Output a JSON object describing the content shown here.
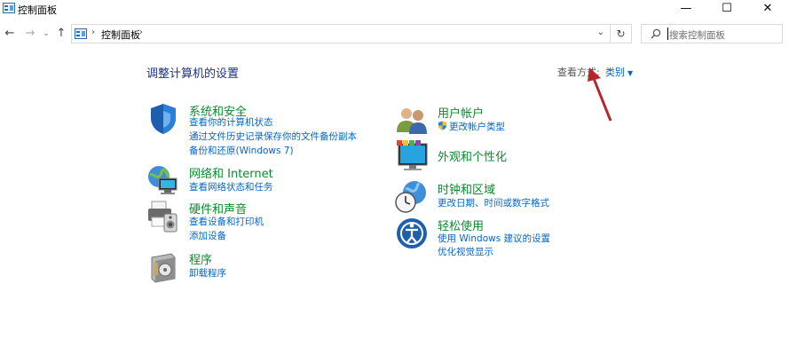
{
  "window": {
    "title": "控制面板",
    "minimize": "—",
    "maximize": "☐",
    "close": "✕"
  },
  "navigation": {
    "back": "←",
    "forward": "→",
    "recent": "⌄",
    "up": "↑",
    "separator": "›",
    "address_text": "控制面板",
    "dropdown": "⌄",
    "refresh": "↻",
    "search_placeholder": "搜索控制面板"
  },
  "main": {
    "heading": "调整计算机的设置",
    "view_by_label": "查看方式:",
    "view_by_value": "类别"
  },
  "left_categories": [
    {
      "title": "系统和安全",
      "links": [
        "查看你的计算机状态",
        "通过文件历史记录保存你的文件备份副本",
        "备份和还原(Windows 7)"
      ]
    },
    {
      "title": "网络和 Internet",
      "links": [
        "查看网络状态和任务"
      ]
    },
    {
      "title": "硬件和声音",
      "links": [
        "查看设备和打印机",
        "添加设备"
      ]
    },
    {
      "title": "程序",
      "links": [
        "卸载程序"
      ]
    }
  ],
  "right_categories": [
    {
      "title": "用户帐户",
      "links": [
        "更改帐户类型"
      ]
    },
    {
      "title": "外观和个性化",
      "links": []
    },
    {
      "title": "时钟和区域",
      "links": [
        "更改日期、时间或数字格式"
      ]
    },
    {
      "title": "轻松使用",
      "links": [
        "使用 Windows 建议的设置",
        "优化视觉显示"
      ]
    }
  ],
  "colors": {
    "category_title": "#0a8a2e",
    "link": "#0066cc",
    "heading": "#1e3287",
    "annotation_arrow": "#b2282b"
  }
}
